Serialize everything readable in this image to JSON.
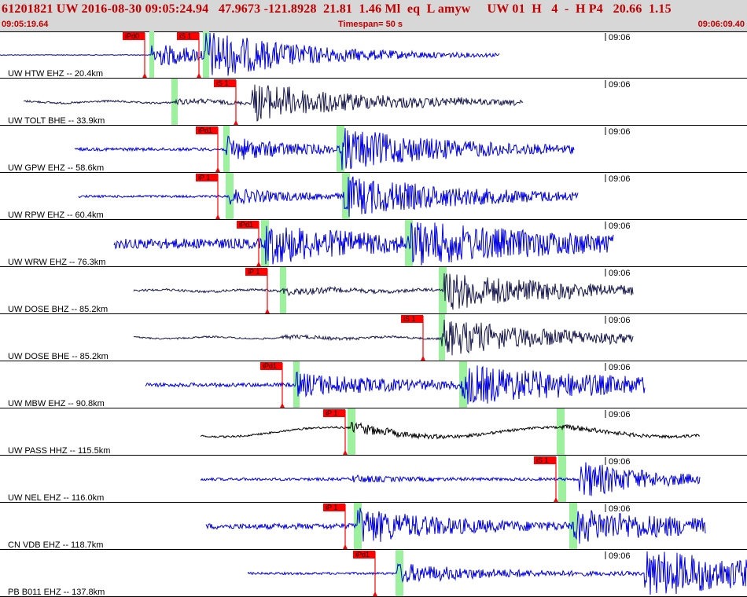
{
  "header": {
    "title": "61201821 UW 2016-08-30 09:05:24.94   47.9673 -121.8928  21.81  1.46 Ml  eq  L amyw     UW 01  H   4  -  H P4   20.66  1.15",
    "start_time": "09:05:19.64",
    "timespan": "Timespan=  50 s",
    "end_time": "09:06:09.40"
  },
  "colors": {
    "header_text": "#c00000",
    "trace_blue": "#0000e0",
    "trace_black": "#1a1a50",
    "pick_bg": "#ff0000",
    "pick_window": "#9df09d",
    "pick_line": "#ff0000"
  },
  "minute_label": "09:06",
  "traces": [
    {
      "label": "UW HTW EHZ -- 20.4km",
      "color": "blue",
      "picks": [
        {
          "label": "iPd0",
          "t": 9.7
        },
        {
          "label": "iS 1",
          "t": 13.3
        }
      ]
    },
    {
      "label": "UW TOLT BHE -- 33.9km",
      "color": "dark",
      "picks": [
        {
          "label": "iS 1",
          "t": 15.8
        }
      ]
    },
    {
      "label": "UW GPW EHZ -- 58.6km",
      "color": "blue",
      "picks": [
        {
          "label": "iPd1",
          "t": 14.6
        }
      ]
    },
    {
      "label": "UW RPW EHZ -- 60.4km",
      "color": "blue",
      "picks": [
        {
          "label": "iP 1",
          "t": 14.6
        }
      ]
    },
    {
      "label": "UW WRW EHZ -- 76.3km",
      "color": "blue",
      "picks": [
        {
          "label": "iPd1",
          "t": 17.3
        }
      ]
    },
    {
      "label": "UW DOSE BHZ -- 85.2km",
      "color": "dark",
      "picks": [
        {
          "label": "iP 1",
          "t": 17.9
        }
      ]
    },
    {
      "label": "UW DOSE BHE -- 85.2km",
      "color": "dark",
      "picks": [
        {
          "label": "iS 1",
          "t": 28.3
        }
      ]
    },
    {
      "label": "UW MBW EHZ -- 90.8km",
      "color": "blue",
      "picks": [
        {
          "label": "iPd1",
          "t": 18.9
        }
      ]
    },
    {
      "label": "UW PASS HHZ -- 115.5km",
      "color": "black",
      "picks": [
        {
          "label": "iP 1",
          "t": 23.1
        }
      ]
    },
    {
      "label": "UW NEL EHZ -- 116.0km",
      "color": "blue",
      "picks": [
        {
          "label": "iS 1",
          "t": 37.2
        }
      ]
    },
    {
      "label": "CN VDB EHZ -- 118.7km",
      "color": "blue",
      "picks": [
        {
          "label": "iP 1",
          "t": 23.1
        }
      ]
    },
    {
      "label": "PB B011 EHZ -- 137.8km",
      "color": "blue",
      "picks": [
        {
          "label": "iPd1",
          "t": 25.1
        }
      ]
    }
  ]
}
